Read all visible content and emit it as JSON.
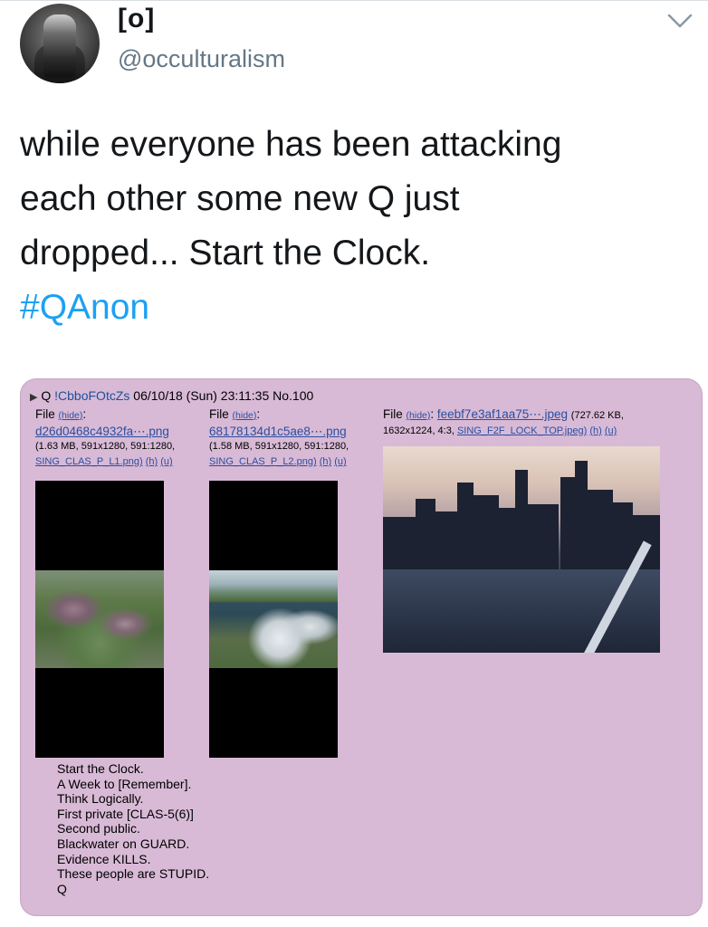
{
  "tweet": {
    "display_name": "[o]",
    "handle": "@occulturalism",
    "text_lines": [
      "while everyone has been attacking",
      "each other some new Q just",
      "dropped... Start the Clock."
    ],
    "hashtag": "#QAnon",
    "menu_icon": "chevron-down-icon"
  },
  "post": {
    "poster": "Q",
    "trip": "!CbboFOtcZs",
    "date": "06/10/18 (Sun) 23:11:35",
    "number": "No.100",
    "files": [
      {
        "label": "File",
        "hide": "(hide)",
        "name": "d26d0468c4932fa⋯.png",
        "meta": "(1.63 MB, 591x1280, 591:1280,",
        "orig": "SING_CLAS_P_L1.png)",
        "h": "(h)",
        "u": "(u)"
      },
      {
        "label": "File",
        "hide": "(hide)",
        "name": "68178134d1c5ae8⋯.png",
        "meta": "(1.58 MB, 591x1280, 591:1280,",
        "orig": "SING_CLAS_P_L2.png)",
        "h": "(h)",
        "u": "(u)"
      },
      {
        "label": "File",
        "hide": "(hide)",
        "name": "feebf7e3af1aa75⋯.jpeg",
        "size": "(727.62 KB,",
        "meta": "1632x1224, 4:3,",
        "orig": "SING_F2F_LOCK_TOP.jpeg)",
        "h": "(h)",
        "u": "(u)"
      }
    ],
    "body_lines": [
      "Start the Clock.",
      "A Week to [Remember].",
      "Think Logically.",
      "First private [CLAS-5(6)]",
      "Second public.",
      "Blackwater on GUARD.",
      "Evidence KILLS.",
      "These people are STUPID.",
      "Q"
    ]
  }
}
